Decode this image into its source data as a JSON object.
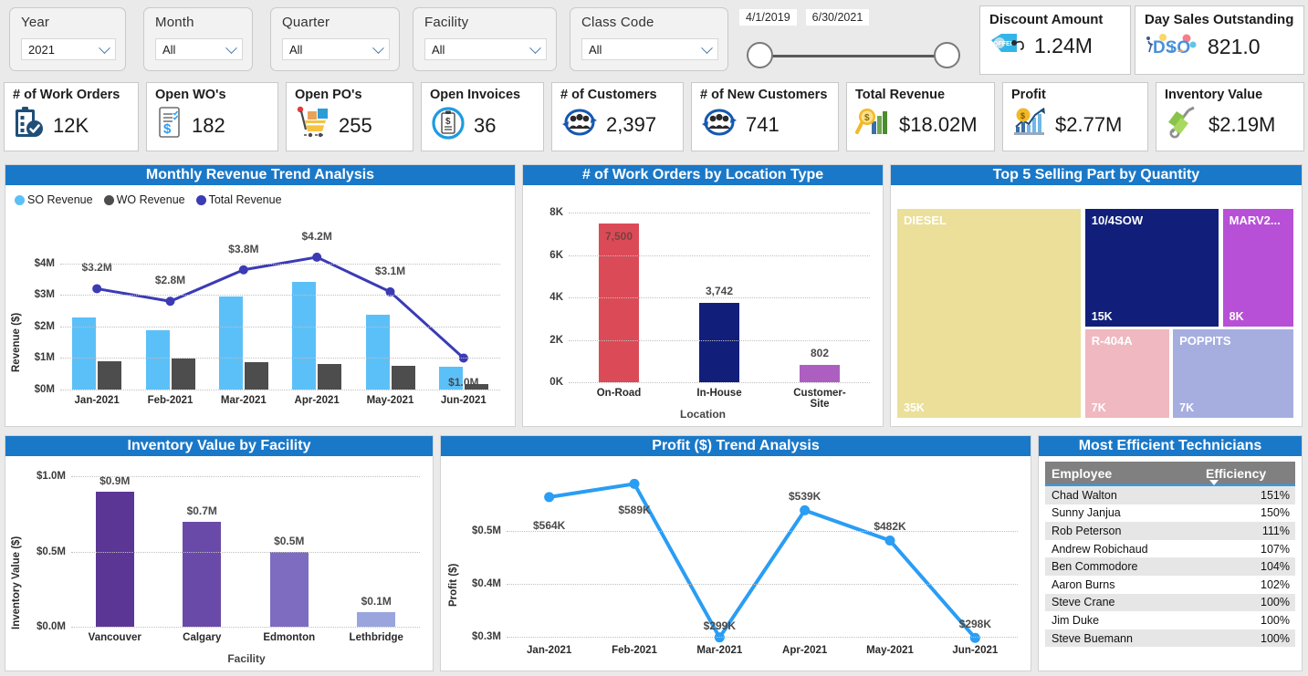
{
  "slicers": [
    {
      "label": "Year",
      "value": "2021",
      "icon": "chevron-down-icon"
    },
    {
      "label": "Month",
      "value": "All",
      "icon": "chevron-down-icon"
    },
    {
      "label": "Quarter",
      "value": "All",
      "icon": "chevron-down-icon"
    },
    {
      "label": "Facility",
      "value": "All",
      "icon": "chevron-down-icon"
    },
    {
      "label": "Class Code",
      "value": "All",
      "icon": "chevron-down-icon"
    }
  ],
  "date_slider": {
    "start": "4/1/2019",
    "end": "6/30/2021"
  },
  "top_kpis": [
    {
      "title": "Discount Amount",
      "value": "1.24M",
      "icon": "offer-tag-icon"
    },
    {
      "title": "Day Sales Outstanding",
      "value": "821.0",
      "icon": "dso-icon"
    }
  ],
  "kpis": [
    {
      "title": "# of Work Orders",
      "value": "12K",
      "icon": "clipboard-check-icon"
    },
    {
      "title": "Open WO's",
      "value": "182",
      "icon": "document-dollar-icon"
    },
    {
      "title": "Open PO's",
      "value": "255",
      "icon": "shopping-cart-icon"
    },
    {
      "title": "Open Invoices",
      "value": "36",
      "icon": "invoice-circle-icon"
    },
    {
      "title": "# of Customers",
      "value": "2,397",
      "icon": "customers-icon"
    },
    {
      "title": "# of  New Customers",
      "value": "741",
      "icon": "new-customers-icon"
    },
    {
      "title": "Total Revenue",
      "value": "$18.02M",
      "icon": "revenue-magnifier-icon"
    },
    {
      "title": "Profit",
      "value": "$2.77M",
      "icon": "profit-chart-icon"
    },
    {
      "title": "Inventory Value",
      "value": "$2.19M",
      "icon": "hand-truck-icon"
    }
  ],
  "panels": {
    "revenue": {
      "title": "Monthly Revenue Trend Analysis"
    },
    "workorders": {
      "title": "# of Work Orders by Location Type"
    },
    "topparts": {
      "title": "Top 5 Selling Part by Quantity"
    },
    "inventory": {
      "title": "Inventory Value by Facility"
    },
    "profit": {
      "title": "Profit ($) Trend Analysis"
    },
    "technicians": {
      "title": "Most Efficient Technicians"
    }
  },
  "technicians_table": {
    "columns": [
      "Employee",
      "Efficiency"
    ],
    "rows": [
      [
        "Chad Walton",
        "151%"
      ],
      [
        "Sunny Janjua",
        "150%"
      ],
      [
        "Rob Peterson",
        "111%"
      ],
      [
        "Andrew Robichaud",
        "107%"
      ],
      [
        "Ben Commodore",
        "104%"
      ],
      [
        "Aaron Burns",
        "102%"
      ],
      [
        "Steve Crane",
        "100%"
      ],
      [
        "Jim Duke",
        "100%"
      ],
      [
        "Steve Buemann",
        "100%"
      ]
    ]
  },
  "chart_data": [
    {
      "id": "revenue",
      "type": "bar",
      "title": "Monthly Revenue Trend Analysis",
      "xlabel": "",
      "ylabel": "Revenue ($)",
      "categories": [
        "Jan-2021",
        "Feb-2021",
        "Mar-2021",
        "Apr-2021",
        "May-2021",
        "Jun-2021"
      ],
      "ylim": [
        0,
        4400000
      ],
      "yticks": [
        "$0M",
        "$1M",
        "$2M",
        "$3M",
        "$4M"
      ],
      "ytick_values": [
        0,
        1000000,
        2000000,
        3000000,
        4000000
      ],
      "grid": true,
      "legend": [
        "SO Revenue",
        "WO Revenue",
        "Total Revenue"
      ],
      "legend_position": "top-left",
      "colors": {
        "so": "#5BC0F8",
        "wo": "#4D4D4D",
        "total": "#3B3BB5"
      },
      "series": [
        {
          "name": "SO Revenue",
          "kind": "bar",
          "color": "#5BC0F8",
          "values": [
            2300000,
            1870000,
            2960000,
            3430000,
            2370000,
            720000
          ]
        },
        {
          "name": "WO Revenue",
          "kind": "bar",
          "color": "#4D4D4D",
          "values": [
            900000,
            980000,
            860000,
            820000,
            740000,
            170000
          ]
        },
        {
          "name": "Total Revenue",
          "kind": "line",
          "color": "#3B3BB5",
          "values": [
            3200000,
            2800000,
            3800000,
            4200000,
            3100000,
            1000000
          ],
          "labels": [
            "$3.2M",
            "$2.8M",
            "$3.8M",
            "$4.2M",
            "$3.1M",
            "$1.0M"
          ]
        }
      ]
    },
    {
      "id": "workorders",
      "type": "bar",
      "title": "# of Work Orders by Location Type",
      "xlabel": "Location",
      "ylabel": "",
      "categories": [
        "On-Road",
        "In-House",
        "Customer-Site"
      ],
      "values": [
        7500,
        3742,
        802
      ],
      "labels": [
        "7,500",
        "3,742",
        "802"
      ],
      "bar_colors": [
        "#DB4B57",
        "#111F7A",
        "#AC5FC0"
      ],
      "ylim": [
        0,
        8000
      ],
      "yticks": [
        "0K",
        "2K",
        "4K",
        "6K",
        "8K"
      ],
      "ytick_values": [
        0,
        2000,
        4000,
        6000,
        8000
      ],
      "grid": true
    },
    {
      "id": "topparts",
      "type": "treemap",
      "title": "Top 5 Selling Part by Quantity",
      "items": [
        {
          "name": "DIESEL",
          "label": "35K",
          "value": 35000,
          "color": "#EBDF9A"
        },
        {
          "name": "10/4SOW",
          "label": "15K",
          "value": 15000,
          "color": "#111F7A"
        },
        {
          "name": "MARV2...",
          "label": "8K",
          "value": 8000,
          "color": "#B750D6"
        },
        {
          "name": "R-404A",
          "label": "7K",
          "value": 7000,
          "color": "#F0B8C0"
        },
        {
          "name": "POPPITS",
          "label": "7K",
          "value": 7000,
          "color": "#A6AEE0"
        }
      ]
    },
    {
      "id": "inventory",
      "type": "bar",
      "title": "Inventory Value by Facility",
      "xlabel": "Facility",
      "ylabel": "Inventory Value ($)",
      "categories": [
        "Vancouver",
        "Calgary",
        "Edmonton",
        "Lethbridge"
      ],
      "values": [
        900000,
        700000,
        500000,
        100000
      ],
      "labels": [
        "$0.9M",
        "$0.7M",
        "$0.5M",
        "$0.1M"
      ],
      "bar_colors": [
        "#5B3695",
        "#6A4AA8",
        "#7E6CC0",
        "#9AA5DE"
      ],
      "ylim": [
        0,
        1000000
      ],
      "yticks": [
        "$0.0M",
        "$0.5M",
        "$1.0M"
      ],
      "ytick_values": [
        0,
        500000,
        1000000
      ],
      "grid": true
    },
    {
      "id": "profit",
      "type": "line",
      "title": "Profit ($) Trend Analysis",
      "xlabel": "",
      "ylabel": "Profit ($)",
      "categories": [
        "Jan-2021",
        "Feb-2021",
        "Mar-2021",
        "Apr-2021",
        "May-2021",
        "Jun-2021"
      ],
      "values": [
        564000,
        589000,
        299000,
        539000,
        482000,
        298000
      ],
      "labels": [
        "$564K",
        "$589K",
        "$299K",
        "$539K",
        "$482K",
        "$298K"
      ],
      "color": "#2A9DF4",
      "ylim": [
        295000,
        600000
      ],
      "yticks": [
        "$0.3M",
        "$0.4M",
        "$0.5M"
      ],
      "ytick_values": [
        300000,
        400000,
        500000
      ],
      "grid": true
    },
    {
      "id": "technicians",
      "type": "table",
      "title": "Most Efficient Technicians",
      "columns": [
        "Employee",
        "Efficiency"
      ],
      "rows": [
        [
          "Chad Walton",
          "151%"
        ],
        [
          "Sunny Janjua",
          "150%"
        ],
        [
          "Rob Peterson",
          "111%"
        ],
        [
          "Andrew Robichaud",
          "107%"
        ],
        [
          "Ben Commodore",
          "104%"
        ],
        [
          "Aaron Burns",
          "102%"
        ],
        [
          "Steve Crane",
          "100%"
        ],
        [
          "Jim Duke",
          "100%"
        ],
        [
          "Steve Buemann",
          "100%"
        ]
      ]
    }
  ]
}
